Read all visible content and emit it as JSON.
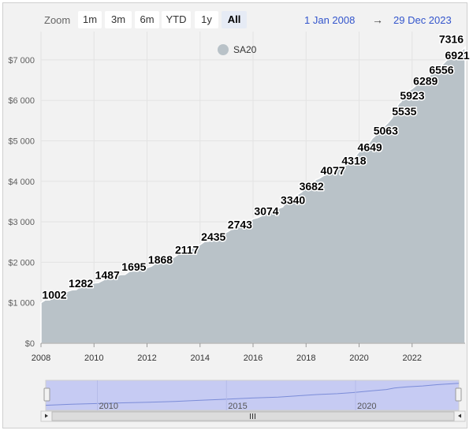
{
  "range_selector": {
    "zoom_label": "Zoom",
    "buttons": [
      "1m",
      "3m",
      "6m",
      "YTD",
      "1y",
      "All"
    ],
    "active": "All",
    "from": "1 Jan 2008",
    "arrow": "→",
    "to": "29 Dec 2023"
  },
  "navigator": {
    "ticks": [
      "2010",
      "2015",
      "2020"
    ]
  },
  "chart_data": {
    "type": "area",
    "series": [
      {
        "name": "SA20",
        "color": "#b9c2c8",
        "points": [
          {
            "x": 2008.0,
            "y": 1002
          },
          {
            "x": 2009.0,
            "y": 1282
          },
          {
            "x": 2010.0,
            "y": 1487
          },
          {
            "x": 2011.0,
            "y": 1695
          },
          {
            "x": 2012.0,
            "y": 1868
          },
          {
            "x": 2013.0,
            "y": 2117
          },
          {
            "x": 2014.0,
            "y": 2435
          },
          {
            "x": 2015.0,
            "y": 2743
          },
          {
            "x": 2016.0,
            "y": 3074
          },
          {
            "x": 2017.0,
            "y": 3340
          },
          {
            "x": 2017.7,
            "y": 3682
          },
          {
            "x": 2018.5,
            "y": 4077
          },
          {
            "x": 2019.3,
            "y": 4318
          },
          {
            "x": 2019.9,
            "y": 4649
          },
          {
            "x": 2020.5,
            "y": 5063
          },
          {
            "x": 2021.2,
            "y": 5535
          },
          {
            "x": 2021.5,
            "y": 5923
          },
          {
            "x": 2022.0,
            "y": 6289
          },
          {
            "x": 2022.6,
            "y": 6556
          },
          {
            "x": 2023.2,
            "y": 6921
          },
          {
            "x": 2024.0,
            "y": 7316
          }
        ]
      }
    ],
    "labeled_values": [
      1002,
      1282,
      1487,
      1695,
      1868,
      2117,
      2435,
      2743,
      3074,
      3340,
      3682,
      4077,
      4318,
      4649,
      5063,
      5535,
      5923,
      6289,
      6556,
      6921,
      7316
    ],
    "y_ticks": [
      "$0",
      "$1 000",
      "$2 000",
      "$3 000",
      "$4 000",
      "$5 000",
      "$6 000",
      "$7 000"
    ],
    "y_tick_values": [
      0,
      1000,
      2000,
      3000,
      4000,
      5000,
      6000,
      7000
    ],
    "x_ticks": [
      "2008",
      "2010",
      "2012",
      "2014",
      "2016",
      "2018",
      "2020",
      "2022"
    ],
    "x_tick_values": [
      2008,
      2010,
      2012,
      2014,
      2016,
      2018,
      2020,
      2022
    ],
    "xlim": [
      2008,
      2024
    ],
    "ylim": [
      0,
      7700
    ],
    "grid": true,
    "legend": "top-center"
  }
}
